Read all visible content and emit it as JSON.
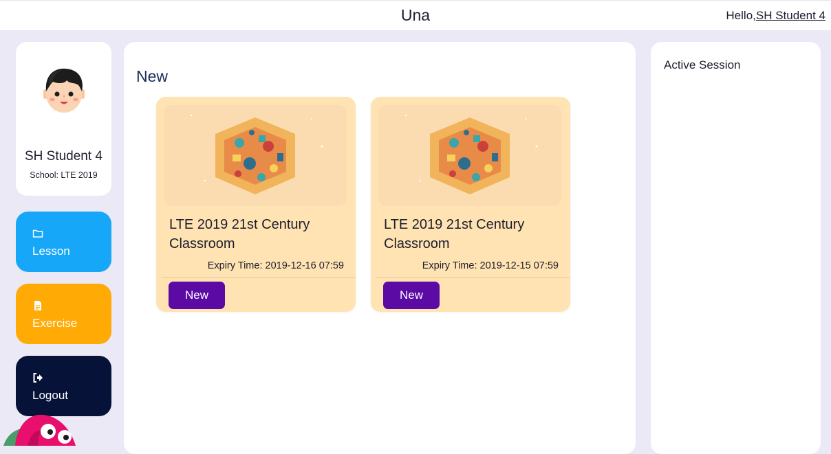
{
  "header": {
    "app_title": "Una",
    "greeting_prefix": "Hello,",
    "user_link": "SH Student 4"
  },
  "profile": {
    "name": "SH Student 4",
    "school": "School: LTE 2019"
  },
  "nav": {
    "lesson": {
      "label": "Lesson",
      "icon": "folder-icon",
      "color": "#17a7f8"
    },
    "exercise": {
      "label": "Exercise",
      "icon": "document-icon",
      "color": "#ffaa05"
    },
    "logout": {
      "label": "Logout",
      "icon": "sign-out-icon",
      "color": "#071239"
    }
  },
  "main": {
    "section_title": "New",
    "cards": [
      {
        "title": "LTE 2019 21st Century Classroom",
        "expiry": "Expiry Time: 2019-12-16 07:59",
        "button": "New"
      },
      {
        "title": "LTE 2019 21st Century Classroom",
        "expiry": "Expiry Time: 2019-12-15 07:59",
        "button": "New"
      }
    ]
  },
  "side": {
    "title": "Active Session"
  },
  "colors": {
    "background": "#ebe9f6",
    "card": "#ffe3b2",
    "new_button": "#5b0aa4"
  }
}
